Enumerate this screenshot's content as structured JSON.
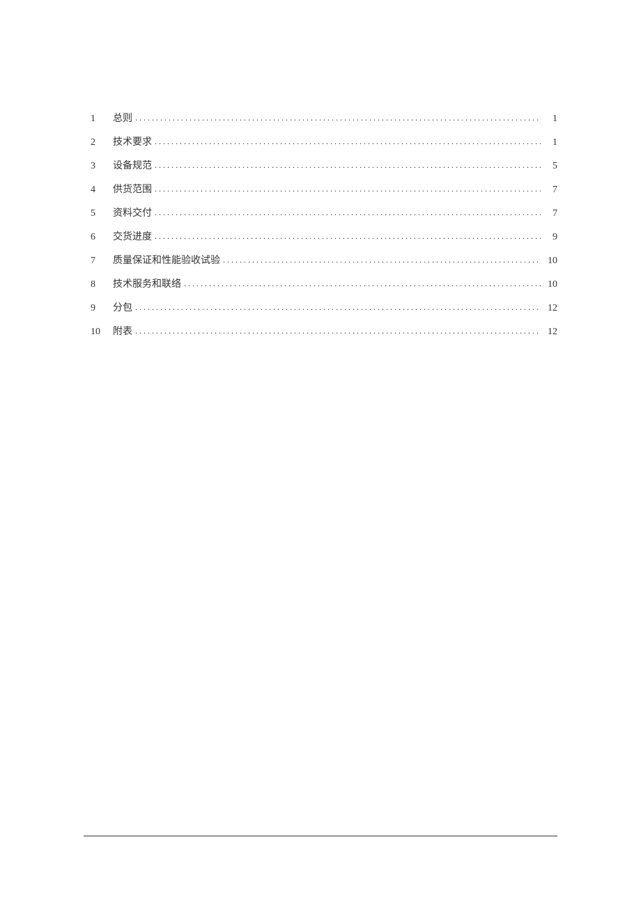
{
  "toc": {
    "entries": [
      {
        "num": "1",
        "title": "总则",
        "page": "1"
      },
      {
        "num": "2",
        "title": "技术要求",
        "page": "1"
      },
      {
        "num": "3",
        "title": "设备规范",
        "page": "5"
      },
      {
        "num": "4",
        "title": "供货范围",
        "page": "7"
      },
      {
        "num": "5",
        "title": "资料交付",
        "page": "7"
      },
      {
        "num": "6",
        "title": "交货进度",
        "page": "9"
      },
      {
        "num": "7",
        "title": "质量保证和性能验收试验",
        "page": "10"
      },
      {
        "num": "8",
        "title": "技术服务和联络",
        "page": "10"
      },
      {
        "num": "9",
        "title": "分包",
        "page": "12"
      },
      {
        "num": "10",
        "title": "附表",
        "page": "12"
      }
    ]
  },
  "dots": "...................................................................................................................................................."
}
